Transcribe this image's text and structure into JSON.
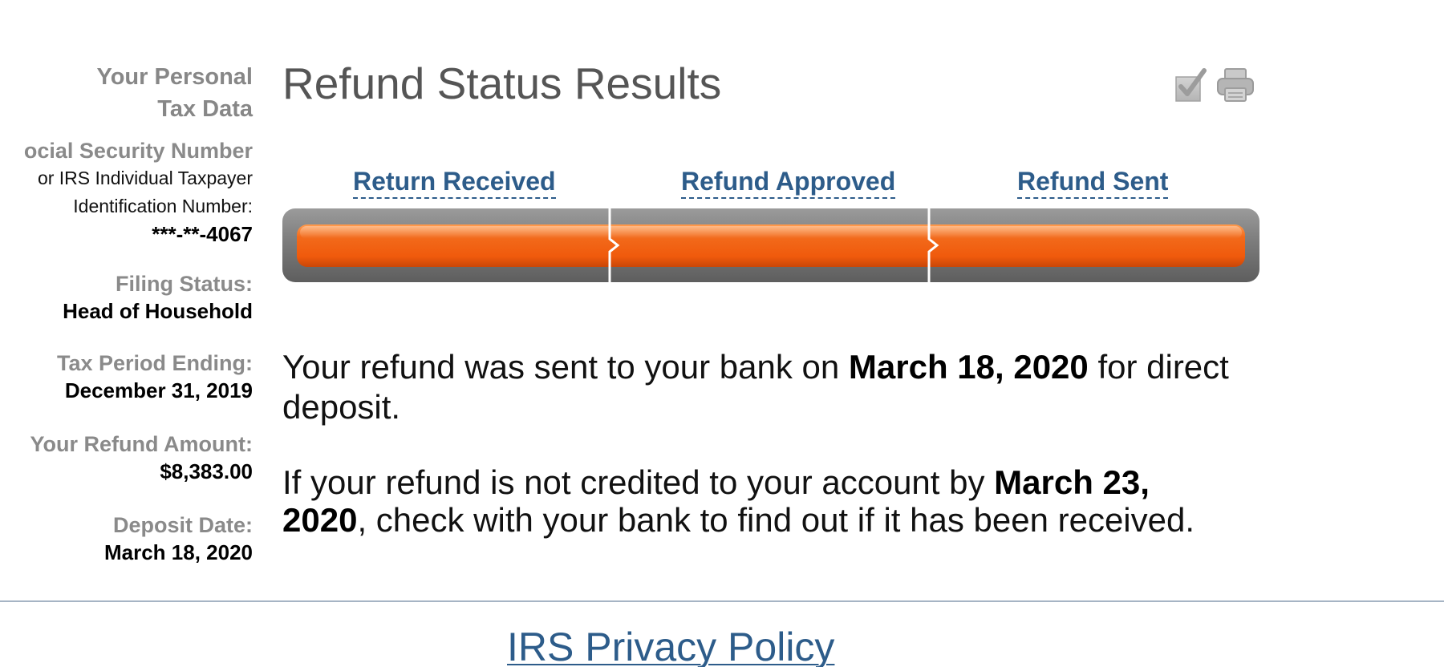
{
  "sidebar": {
    "heading_line1": "Your Personal",
    "heading_line2": "Tax Data",
    "ssn": {
      "label": "ocial Security Number",
      "sub1": "or IRS Individual Taxpayer",
      "sub2": "Identification Number:",
      "value": "***-**-4067"
    },
    "filing_status": {
      "label": "Filing Status:",
      "value": "Head of Household"
    },
    "tax_period": {
      "label": "Tax Period Ending:",
      "value": "December 31, 2019"
    },
    "refund_amount": {
      "label": "Your Refund Amount:",
      "value": "$8,383.00"
    },
    "deposit_date": {
      "label": "Deposit Date:",
      "value": "March 18, 2020"
    }
  },
  "main": {
    "title": "Refund Status Results",
    "icons": [
      "checkmark-icon",
      "printer-icon"
    ],
    "steps": [
      {
        "label": "Return Received",
        "complete": true
      },
      {
        "label": "Refund Approved",
        "complete": true
      },
      {
        "label": "Refund Sent",
        "complete": true
      }
    ],
    "progress_color": "#f26a1b",
    "message1": {
      "pre": "Your refund was sent to your bank on ",
      "date": "March 18, 2020",
      "post": " for direct deposit."
    },
    "message2": {
      "pre": "If your refund is not credited to your account by ",
      "date": "March 23, 2020",
      "post": ", check with your bank to find out if it has been received."
    }
  },
  "footer": {
    "privacy_link": "IRS Privacy Policy"
  }
}
